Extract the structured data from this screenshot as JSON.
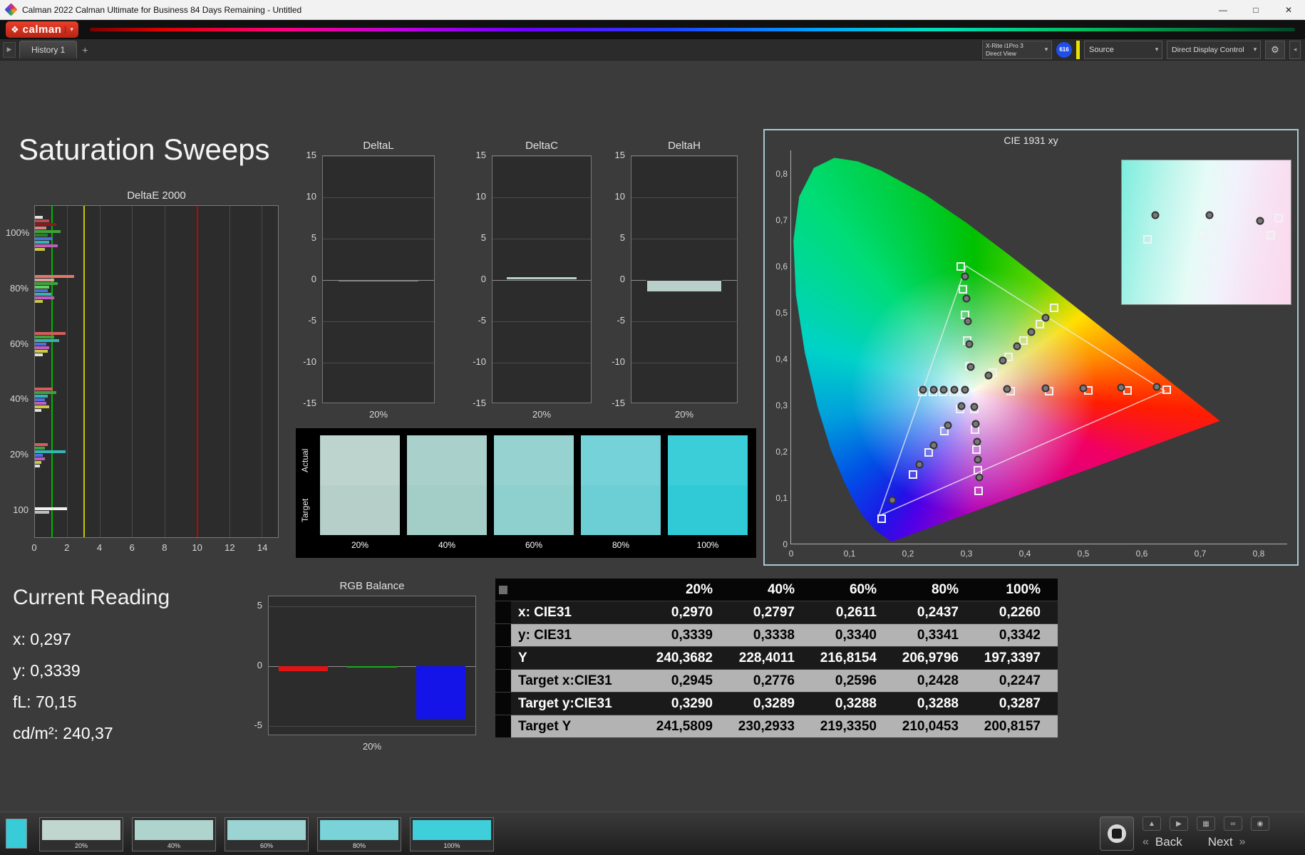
{
  "window": {
    "title": "Calman 2022 Calman Ultimate for Business 84 Days Remaining  - Untitled",
    "controls": {
      "minimize": "—",
      "maximize": "□",
      "close": "✕"
    }
  },
  "brand": {
    "name": "calman",
    "diamond": "❖",
    "caret": "▾"
  },
  "tabs": {
    "collapse_arrow": "▶",
    "history_tab": "History 1",
    "add_tab": "+"
  },
  "meter_bar": {
    "meter_line1": "X-Rite i1Pro 3",
    "meter_line2": "Direct View",
    "badge": "616",
    "source_label": "Source",
    "display_control_label": "Direct Display Control",
    "gear": "⚙",
    "caret": "▾",
    "collapse": "◂"
  },
  "page": {
    "title": "Saturation Sweeps"
  },
  "current_reading": {
    "title": "Current Reading",
    "x": "x: 0,297",
    "y": "y: 0,3339",
    "fl": "fL: 70,15",
    "cdm2": "cd/m²: 240,37"
  },
  "swatch_panel": {
    "row_top": "Actual",
    "row_bottom": "Target",
    "items": [
      {
        "label": "20%",
        "actual": "#bdd3cd",
        "target": "#b6d0c9"
      },
      {
        "label": "40%",
        "actual": "#aad0cb",
        "target": "#a3cdc7"
      },
      {
        "label": "60%",
        "actual": "#95d2d0",
        "target": "#8ed0cd"
      },
      {
        "label": "80%",
        "actual": "#74d2d8",
        "target": "#6bcfd5"
      },
      {
        "label": "100%",
        "actual": "#3bced9",
        "target": "#2fcad6"
      }
    ]
  },
  "table": {
    "headers": [
      "20%",
      "40%",
      "60%",
      "80%",
      "100%"
    ],
    "rows": [
      {
        "label": "x: CIE31",
        "values": [
          "0,2970",
          "0,2797",
          "0,2611",
          "0,2437",
          "0,2260"
        ],
        "dark": true
      },
      {
        "label": "y: CIE31",
        "values": [
          "0,3339",
          "0,3338",
          "0,3340",
          "0,3341",
          "0,3342"
        ],
        "dark": false
      },
      {
        "label": "Y",
        "values": [
          "240,3682",
          "228,4011",
          "216,8154",
          "206,9796",
          "197,3397"
        ],
        "dark": true
      },
      {
        "label": "Target x:CIE31",
        "values": [
          "0,2945",
          "0,2776",
          "0,2596",
          "0,2428",
          "0,2247"
        ],
        "dark": false
      },
      {
        "label": "Target y:CIE31",
        "values": [
          "0,3290",
          "0,3289",
          "0,3288",
          "0,3288",
          "0,3287"
        ],
        "dark": true
      },
      {
        "label": "Target Y",
        "values": [
          "241,5809",
          "230,2933",
          "219,3350",
          "210,0453",
          "200,8157"
        ],
        "dark": false
      }
    ]
  },
  "bottom_bar": {
    "mini_swatch_color": "#38cbd8",
    "swatches": [
      {
        "label": "20%",
        "color": "#c2d6d0"
      },
      {
        "label": "40%",
        "color": "#afd3cd"
      },
      {
        "label": "60%",
        "color": "#9bd4d2"
      },
      {
        "label": "80%",
        "color": "#7ad3d8"
      },
      {
        "label": "100%",
        "color": "#3ecfda"
      }
    ],
    "icons": [
      "▲",
      "▶",
      "▦",
      "∞",
      "◉"
    ],
    "back_icon": "«",
    "next_icon": "»",
    "back_label": "Back",
    "next_label": "Next"
  },
  "chart_data": [
    {
      "id": "deltaE",
      "type": "bar",
      "orientation": "horizontal",
      "title": "DeltaE 2000",
      "xlim": [
        0,
        15
      ],
      "x_ticks": [
        0,
        2,
        4,
        6,
        8,
        10,
        12,
        14
      ],
      "reference_lines": [
        {
          "value": 1,
          "color": "#00b400"
        },
        {
          "value": 3,
          "color": "#c8c800"
        },
        {
          "value": 10,
          "color": "#c80000"
        }
      ],
      "groups": [
        {
          "label": "100%",
          "bars": [
            {
              "color": "#e0e0e0",
              "value": 0.5
            },
            {
              "color": "#c04848",
              "value": 0.9
            },
            {
              "color": "#8b1a1a",
              "value": 1.3
            },
            {
              "color": "#e08080",
              "value": 0.7
            },
            {
              "color": "#3da43d",
              "value": 1.6
            },
            {
              "color": "#2e7d2e",
              "value": 0.8
            },
            {
              "color": "#4f6fd9",
              "value": 1.1
            },
            {
              "color": "#37b3b3",
              "value": 0.9
            },
            {
              "color": "#c05cc0",
              "value": 1.4
            },
            {
              "color": "#c9c943",
              "value": 0.6
            }
          ]
        },
        {
          "label": "80%",
          "bars": [
            {
              "color": "#e07a6a",
              "value": 2.4
            },
            {
              "color": "#d9a0a0",
              "value": 1.2
            },
            {
              "color": "#3da43d",
              "value": 1.4
            },
            {
              "color": "#66cc66",
              "value": 0.9
            },
            {
              "color": "#4f6fd9",
              "value": 0.8
            },
            {
              "color": "#37b3b3",
              "value": 1.0
            },
            {
              "color": "#c05cc0",
              "value": 1.2
            },
            {
              "color": "#c9c943",
              "value": 0.5
            }
          ]
        },
        {
          "label": "60%",
          "bars": [
            {
              "color": "#d95c5c",
              "value": 1.9
            },
            {
              "color": "#3da43d",
              "value": 1.2
            },
            {
              "color": "#37b3b3",
              "value": 1.5
            },
            {
              "color": "#4f6fd9",
              "value": 0.7
            },
            {
              "color": "#c05cc0",
              "value": 0.9
            },
            {
              "color": "#c9c943",
              "value": 0.8
            },
            {
              "color": "#e0e0e0",
              "value": 0.5
            }
          ]
        },
        {
          "label": "40%",
          "bars": [
            {
              "color": "#d95c5c",
              "value": 1.1
            },
            {
              "color": "#3da43d",
              "value": 1.3
            },
            {
              "color": "#37b3b3",
              "value": 0.8
            },
            {
              "color": "#4f6fd9",
              "value": 0.6
            },
            {
              "color": "#c05cc0",
              "value": 0.7
            },
            {
              "color": "#c9c943",
              "value": 0.9
            },
            {
              "color": "#e0e0e0",
              "value": 0.4
            }
          ]
        },
        {
          "label": "20%",
          "bars": [
            {
              "color": "#d95c5c",
              "value": 0.8
            },
            {
              "color": "#3da43d",
              "value": 0.6
            },
            {
              "color": "#37b3b3",
              "value": 1.9
            },
            {
              "color": "#4f6fd9",
              "value": 0.5
            },
            {
              "color": "#c05cc0",
              "value": 0.6
            },
            {
              "color": "#c9c943",
              "value": 0.4
            },
            {
              "color": "#e0e0e0",
              "value": 0.3
            }
          ]
        },
        {
          "label": "100",
          "bars": [
            {
              "color": "#f0f0f0",
              "value": 2.0
            },
            {
              "color": "#bdbdbd",
              "value": 0.9
            }
          ]
        }
      ]
    },
    {
      "id": "deltaL",
      "type": "bar",
      "title": "DeltaL",
      "ylim": [
        -15,
        15
      ],
      "y_ticks": [
        15,
        10,
        5,
        0,
        -5,
        -10,
        -15
      ],
      "categories": [
        "20%"
      ],
      "values": [
        -0.2
      ],
      "bar_color": "#141414",
      "bar_border": "#8a8a8a"
    },
    {
      "id": "deltaC",
      "type": "bar",
      "title": "DeltaC",
      "ylim": [
        -15,
        15
      ],
      "y_ticks": [
        15,
        10,
        5,
        0,
        -5,
        -10,
        -15
      ],
      "categories": [
        "20%"
      ],
      "values": [
        0.4
      ],
      "bar_color": "#b9cfc9",
      "bar_border": "#2a2a2a"
    },
    {
      "id": "deltaH",
      "type": "bar",
      "title": "DeltaH",
      "ylim": [
        -15,
        15
      ],
      "y_ticks": [
        15,
        10,
        5,
        0,
        -5,
        -10,
        -15
      ],
      "categories": [
        "20%"
      ],
      "values": [
        -1.5
      ],
      "bar_color": "#b9cfc9",
      "bar_border": "#2a2a2a"
    },
    {
      "id": "rgb",
      "type": "bar",
      "title": "RGB Balance",
      "ylim": [
        -5.8,
        5.8
      ],
      "y_ticks": [
        5,
        0,
        -5
      ],
      "categories": [
        "20%"
      ],
      "series": [
        {
          "name": "Red",
          "color": "#e01414",
          "value": -0.4
        },
        {
          "name": "Green",
          "color": "#14b014",
          "value": 0
        },
        {
          "name": "Blue",
          "color": "#1414e8",
          "value": -4.4
        }
      ]
    },
    {
      "id": "cie",
      "type": "scatter",
      "title": "CIE 1931 xy",
      "xlim": [
        0,
        0.85
      ],
      "ylim": [
        0,
        0.85
      ],
      "x_ticks": [
        {
          "v": 0,
          "l": "0"
        },
        {
          "v": 0.1,
          "l": "0,1"
        },
        {
          "v": 0.2,
          "l": "0,2"
        },
        {
          "v": 0.3,
          "l": "0,3"
        },
        {
          "v": 0.4,
          "l": "0,4"
        },
        {
          "v": 0.5,
          "l": "0,5"
        },
        {
          "v": 0.6,
          "l": "0,6"
        },
        {
          "v": 0.7,
          "l": "0,7"
        },
        {
          "v": 0.8,
          "l": "0,8"
        }
      ],
      "y_ticks": [
        {
          "v": 0,
          "l": "0"
        },
        {
          "v": 0.1,
          "l": "0,1"
        },
        {
          "v": 0.2,
          "l": "0,2"
        },
        {
          "v": 0.3,
          "l": "0,3"
        },
        {
          "v": 0.4,
          "l": "0,4"
        },
        {
          "v": 0.5,
          "l": "0,5"
        },
        {
          "v": 0.6,
          "l": "0,6"
        },
        {
          "v": 0.7,
          "l": "0,7"
        },
        {
          "v": 0.8,
          "l": "0,8"
        }
      ],
      "white_point": [
        0.3127,
        0.329
      ],
      "gamut_triangle": [
        [
          0.64,
          0.33
        ],
        [
          0.3,
          0.6
        ],
        [
          0.15,
          0.06
        ]
      ],
      "spectral_locus": [
        [
          0.1741,
          0.005
        ],
        [
          0.1738,
          0.0049
        ],
        [
          0.1733,
          0.0048
        ],
        [
          0.1726,
          0.0048
        ],
        [
          0.1714,
          0.0051
        ],
        [
          0.1689,
          0.0069
        ],
        [
          0.1644,
          0.0109
        ],
        [
          0.1566,
          0.0177
        ],
        [
          0.144,
          0.0297
        ],
        [
          0.1241,
          0.0578
        ],
        [
          0.1096,
          0.0868
        ],
        [
          0.0913,
          0.1327
        ],
        [
          0.0687,
          0.2007
        ],
        [
          0.0454,
          0.295
        ],
        [
          0.0235,
          0.4127
        ],
        [
          0.0082,
          0.5384
        ],
        [
          0.0039,
          0.6548
        ],
        [
          0.0139,
          0.7502
        ],
        [
          0.0389,
          0.812
        ],
        [
          0.0743,
          0.8338
        ],
        [
          0.1142,
          0.8262
        ],
        [
          0.1547,
          0.8059
        ],
        [
          0.2296,
          0.7543
        ],
        [
          0.3016,
          0.6923
        ],
        [
          0.3731,
          0.6245
        ],
        [
          0.4441,
          0.5547
        ],
        [
          0.5125,
          0.4866
        ],
        [
          0.5752,
          0.4242
        ],
        [
          0.627,
          0.3725
        ],
        [
          0.6658,
          0.334
        ],
        [
          0.6915,
          0.3083
        ],
        [
          0.714,
          0.2859
        ],
        [
          0.726,
          0.274
        ],
        [
          0.7347,
          0.2653
        ]
      ],
      "measured": [
        [
          0.297,
          0.334
        ],
        [
          0.2797,
          0.334
        ],
        [
          0.2611,
          0.334
        ],
        [
          0.2437,
          0.334
        ],
        [
          0.226,
          0.334
        ],
        [
          0.307,
          0.383
        ],
        [
          0.305,
          0.432
        ],
        [
          0.302,
          0.481
        ],
        [
          0.3,
          0.53
        ],
        [
          0.298,
          0.578
        ],
        [
          0.338,
          0.365
        ],
        [
          0.362,
          0.396
        ],
        [
          0.387,
          0.427
        ],
        [
          0.411,
          0.458
        ],
        [
          0.435,
          0.489
        ],
        [
          0.37,
          0.335
        ],
        [
          0.435,
          0.336
        ],
        [
          0.5,
          0.337
        ],
        [
          0.565,
          0.338
        ],
        [
          0.625,
          0.339
        ],
        [
          0.292,
          0.298
        ],
        [
          0.268,
          0.256
        ],
        [
          0.244,
          0.214
        ],
        [
          0.22,
          0.172
        ],
        [
          0.173,
          0.095
        ],
        [
          0.314,
          0.297
        ],
        [
          0.316,
          0.259
        ],
        [
          0.318,
          0.221
        ],
        [
          0.32,
          0.183
        ],
        [
          0.322,
          0.145
        ]
      ],
      "targets": [
        [
          0.2945,
          0.329
        ],
        [
          0.2776,
          0.329
        ],
        [
          0.2596,
          0.329
        ],
        [
          0.2428,
          0.329
        ],
        [
          0.2247,
          0.329
        ],
        [
          0.305,
          0.385
        ],
        [
          0.301,
          0.44
        ],
        [
          0.298,
          0.495
        ],
        [
          0.294,
          0.55
        ],
        [
          0.29,
          0.6
        ],
        [
          0.345,
          0.37
        ],
        [
          0.372,
          0.405
        ],
        [
          0.398,
          0.44
        ],
        [
          0.425,
          0.475
        ],
        [
          0.45,
          0.51
        ],
        [
          0.375,
          0.331
        ],
        [
          0.442,
          0.331
        ],
        [
          0.509,
          0.332
        ],
        [
          0.576,
          0.332
        ],
        [
          0.643,
          0.333
        ],
        [
          0.289,
          0.292
        ],
        [
          0.262,
          0.245
        ],
        [
          0.235,
          0.198
        ],
        [
          0.208,
          0.151
        ],
        [
          0.155,
          0.055
        ],
        [
          0.313,
          0.292
        ],
        [
          0.315,
          0.248
        ],
        [
          0.317,
          0.204
        ],
        [
          0.319,
          0.16
        ],
        [
          0.321,
          0.116
        ]
      ],
      "inset": {
        "measured": [
          [
            0.2,
            0.38
          ],
          [
            0.52,
            0.38
          ],
          [
            0.82,
            0.42
          ]
        ],
        "targets": [
          [
            0.15,
            0.55
          ],
          [
            0.48,
            0.52
          ],
          [
            0.88,
            0.52
          ],
          [
            0.93,
            0.4
          ]
        ]
      }
    }
  ]
}
